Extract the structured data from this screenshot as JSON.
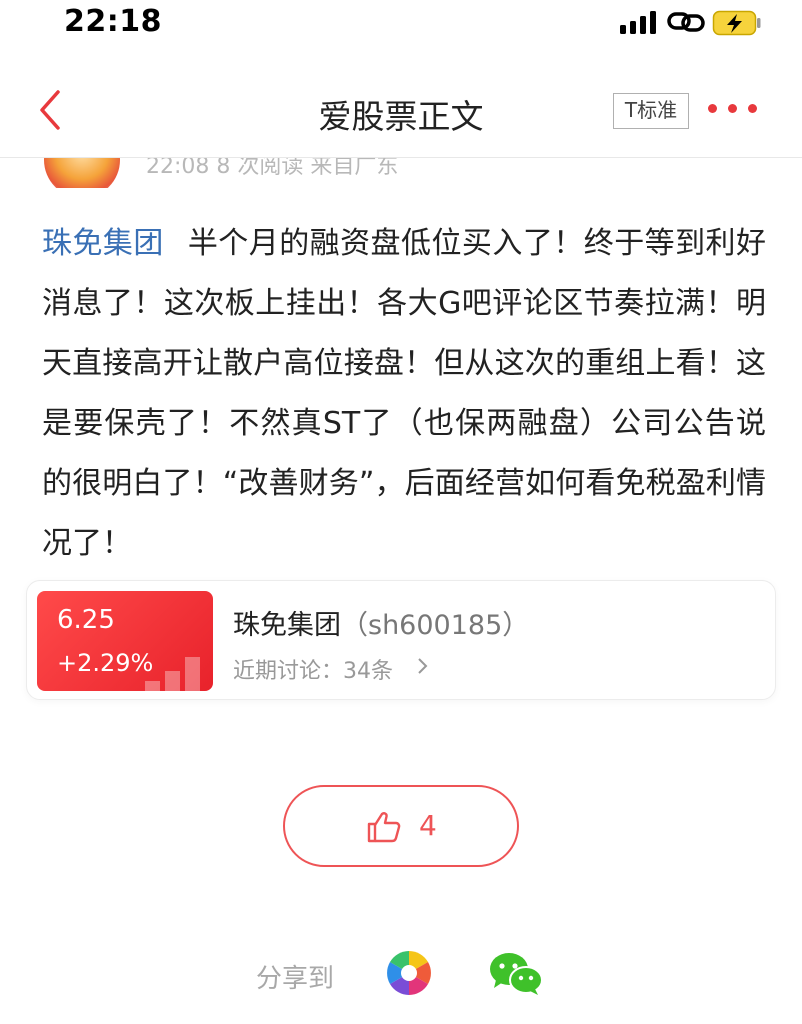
{
  "status_bar": {
    "time": "22:18"
  },
  "nav": {
    "title": "爱股票正文",
    "font_button_label": "T标准"
  },
  "author": {
    "meta": "22:08 8 次阅读 来自广东"
  },
  "post": {
    "stock_tag": "珠免集团",
    "text": "半个月的融资盘低位买入了！终于等到利好消息了！这次板上挂出！各大G吧评论区节奏拉满！明天直接高开让散户高位接盘！但从这次的重组上看！这是要保壳了！不然真ST了（也保两融盘）公司公告说的很明白了！“改善财务”，后面经营如何看免税盈利情况了！"
  },
  "stock_card": {
    "price": "6.25",
    "change": "+2.29%",
    "name": "珠免集团",
    "code": "（sh600185）",
    "discussion": "近期讨论：34条"
  },
  "like": {
    "count": "4"
  },
  "share": {
    "label": "分享到"
  },
  "colors": {
    "accent_red": "#e8393d",
    "link_blue": "#3a70b5",
    "wechat_green": "#3fc12a"
  },
  "icons": [
    "back-arrow-icon",
    "more-dots-icon",
    "thumbs-up-icon",
    "share-stock-app-icon",
    "wechat-icon"
  ]
}
